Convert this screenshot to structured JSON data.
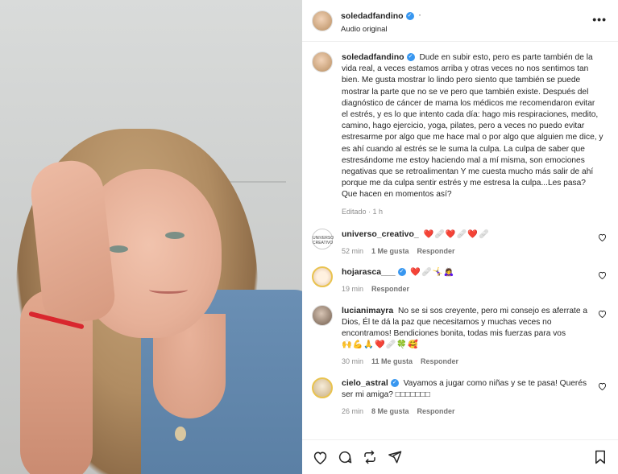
{
  "post": {
    "username": "soledadfandino",
    "audio": "Audio original",
    "more_icon": "more-dots-icon"
  },
  "caption": {
    "username": "soledadfandino",
    "text": "Dude en subir esto, pero es parte también de la vida real, a veces estamos arriba y otras veces no nos sentimos tan bien. Me gusta mostrar lo lindo pero siento que también se puede mostrar la parte que no se ve pero que también existe. Después del diagnóstico de cáncer de mama los médicos me recomendaron evitar el estrés, y es lo que intento cada día: hago mis respiraciones, medito, camino, hago ejercicio, yoga, pilates, pero a veces no puedo evitar estresarme por algo que me hace mal o por algo que alguien me dice, y es ahí cuando al estrés se le suma la culpa. La culpa de saber que estresándome me estoy haciendo mal a mí misma, son emociones negativas que se retroalimentan Y me cuesta mucho más salir de ahí porque me da culpa sentir estrés y me estresa la culpa...Les pasa? Que hacen en momentos así?",
    "edited": "Editado · 1 h"
  },
  "comments": [
    {
      "username": "universo_creativo_",
      "avatar_text": "UNIVERSO CREATIVO",
      "text": "❤️🩹❤️🩹❤️🩹",
      "time": "52 min",
      "likes": "1 Me gusta",
      "reply": "Responder"
    },
    {
      "username": "hojarasca___",
      "text": "❤️🩹🤸‍♀️🙇‍♀️",
      "time": "19 min",
      "reply": "Responder"
    },
    {
      "username": "lucianimayra",
      "text": "No se si sos creyente, pero mi consejo es aferrate a Dios, Él te dá la paz que necesitamos y muchas veces no encontramos! Bendiciones bonita, todas mis fuerzas para vos",
      "emojis": "🙌💪🙏❤️🩹🍀🥰",
      "time": "30 min",
      "likes": "11 Me gusta",
      "reply": "Responder"
    },
    {
      "username": "cielo_astral",
      "text": "Vayamos a jugar como niñas y se te pasa! Querés ser mi amiga? □□□□□□□",
      "time": "26 min",
      "likes": "8 Me gusta",
      "reply": "Responder"
    }
  ],
  "actions": {
    "like_icon": "heart-icon",
    "comment_icon": "comment-icon",
    "share_icon": "repost-icon",
    "send_icon": "send-icon",
    "save_icon": "bookmark-icon"
  },
  "colors": {
    "verified": "#3897f0",
    "muted": "#8e8e8e",
    "text": "#262626"
  }
}
